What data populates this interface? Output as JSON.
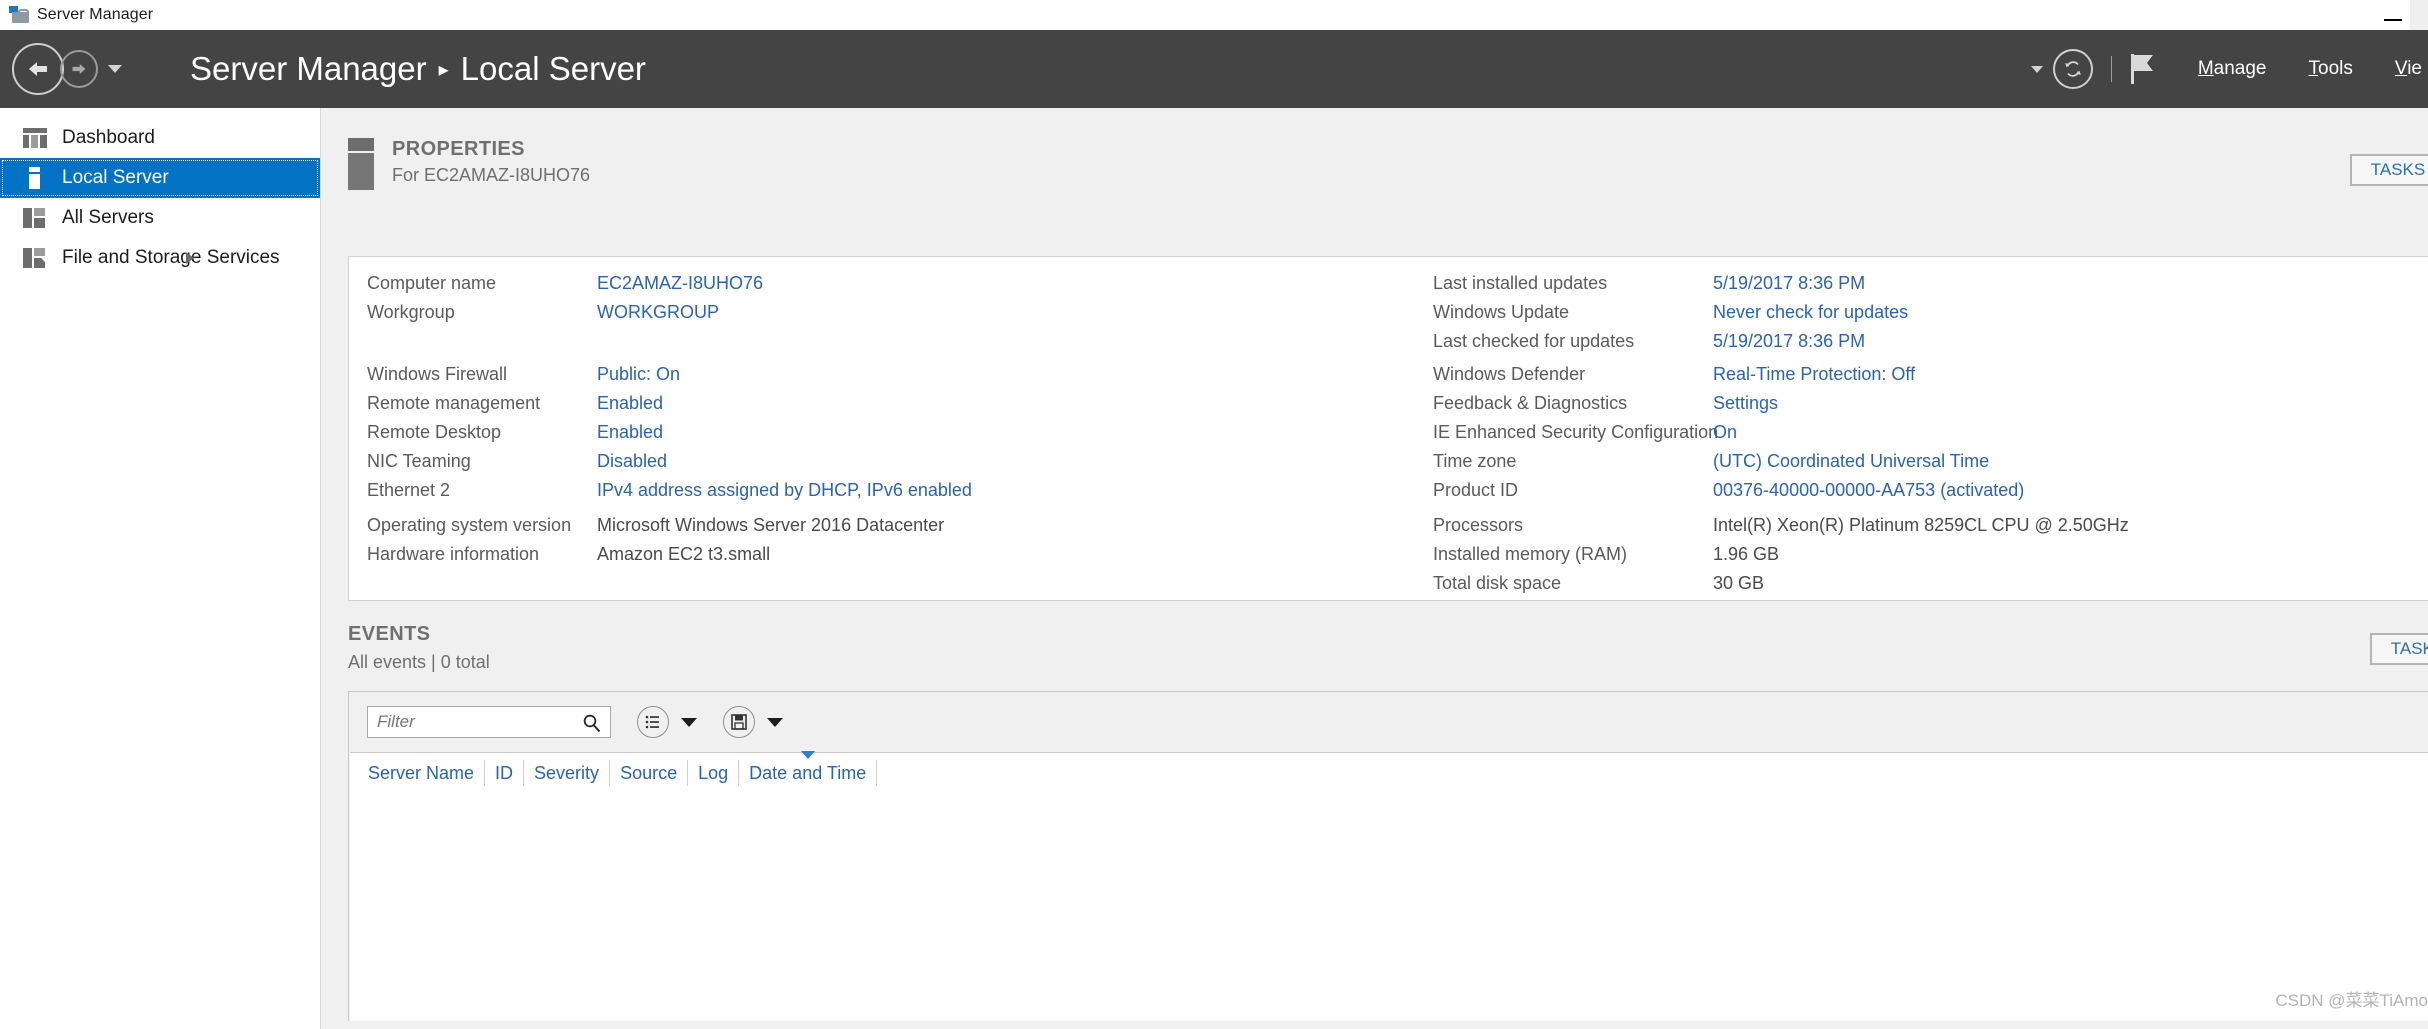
{
  "window": {
    "title": "Server Manager",
    "icon": "server-manager-icon",
    "minimize_label": "Minimize"
  },
  "nav": {
    "back_icon": "back-arrow-icon",
    "forward_icon": "forward-arrow-icon",
    "history_caret_icon": "chevron-down-icon",
    "breadcrumb_root": "Server Manager",
    "breadcrumb_separator": "▸",
    "breadcrumb_leaf": "Local Server",
    "notifications_caret_icon": "chevron-down-icon",
    "refresh_icon": "refresh-icon",
    "flag_icon": "flag-icon",
    "menus": [
      {
        "label": "Manage",
        "accel": "M"
      },
      {
        "label": "Tools",
        "accel": "T"
      },
      {
        "label": "Vie",
        "accel": "V"
      }
    ]
  },
  "sidebar": {
    "items": [
      {
        "label": "Dashboard",
        "icon": "dashboard-icon",
        "active": false,
        "expandable": false
      },
      {
        "label": "Local Server",
        "icon": "local-server-icon",
        "active": true,
        "expandable": false
      },
      {
        "label": "All Servers",
        "icon": "all-servers-icon",
        "active": false,
        "expandable": false
      },
      {
        "label": "File and Storage Services",
        "icon": "file-storage-icon",
        "active": false,
        "expandable": true
      }
    ]
  },
  "properties": {
    "icon": "properties-server-icon",
    "title": "PROPERTIES",
    "subtitle": "For EC2AMAZ-I8UHO76",
    "tasks_label": "TASKS",
    "left_group_1": [
      {
        "label": "Computer name",
        "value": "EC2AMAZ-I8UHO76",
        "link": true
      },
      {
        "label": "Workgroup",
        "value": "WORKGROUP",
        "link": true
      }
    ],
    "left_group_2": [
      {
        "label": "Windows Firewall",
        "value": "Public: On",
        "link": true
      },
      {
        "label": "Remote management",
        "value": "Enabled",
        "link": true
      },
      {
        "label": "Remote Desktop",
        "value": "Enabled",
        "link": true
      },
      {
        "label": "NIC Teaming",
        "value": "Disabled",
        "link": true
      },
      {
        "label": "Ethernet 2",
        "value": "IPv4 address assigned by DHCP, IPv6 enabled",
        "link": true
      }
    ],
    "left_group_3": [
      {
        "label": "Operating system version",
        "value": "Microsoft Windows Server 2016 Datacenter",
        "link": false
      },
      {
        "label": "Hardware information",
        "value": "Amazon EC2 t3.small",
        "link": false
      }
    ],
    "right_group_1": [
      {
        "label": "Last installed updates",
        "value": "5/19/2017 8:36 PM",
        "link": true
      },
      {
        "label": "Windows Update",
        "value": "Never check for updates",
        "link": true
      },
      {
        "label": "Last checked for updates",
        "value": "5/19/2017 8:36 PM",
        "link": true
      }
    ],
    "right_group_2": [
      {
        "label": "Windows Defender",
        "value": "Real-Time Protection: Off",
        "link": true
      },
      {
        "label": "Feedback & Diagnostics",
        "value": "Settings",
        "link": true
      },
      {
        "label": "IE Enhanced Security Configuration",
        "value": "On",
        "link": true
      },
      {
        "label": "Time zone",
        "value": "(UTC) Coordinated Universal Time",
        "link": true
      },
      {
        "label": "Product ID",
        "value": "00376-40000-00000-AA753 (activated)",
        "link": true
      }
    ],
    "right_group_3": [
      {
        "label": "Processors",
        "value": "Intel(R) Xeon(R) Platinum 8259CL CPU @ 2.50GHz",
        "link": false
      },
      {
        "label": "Installed memory (RAM)",
        "value": "1.96 GB",
        "link": false
      },
      {
        "label": "Total disk space",
        "value": "30 GB",
        "link": false
      }
    ]
  },
  "events": {
    "title": "EVENTS",
    "subtitle": "All events | 0 total",
    "tasks_label": "TASKS",
    "filter": {
      "value": "",
      "placeholder": "Filter",
      "search_icon": "search-icon"
    },
    "query_button_icon": "query-list-icon",
    "query_caret_icon": "chevron-down-icon",
    "save_button_icon": "save-disk-icon",
    "save_caret_icon": "chevron-down-icon",
    "columns": [
      {
        "label": "Server Name",
        "sorted": false
      },
      {
        "label": "ID",
        "sorted": false
      },
      {
        "label": "Severity",
        "sorted": false
      },
      {
        "label": "Source",
        "sorted": false
      },
      {
        "label": "Log",
        "sorted": false
      },
      {
        "label": "Date and Time",
        "sorted": true
      }
    ],
    "rows": []
  },
  "watermark": "CSDN @菜菜TiAmo",
  "colors": {
    "accent_blue": "#0272c4",
    "link_blue": "#2a63b0",
    "nav_dark": "#444444",
    "content_bg": "#f0f0f0"
  }
}
